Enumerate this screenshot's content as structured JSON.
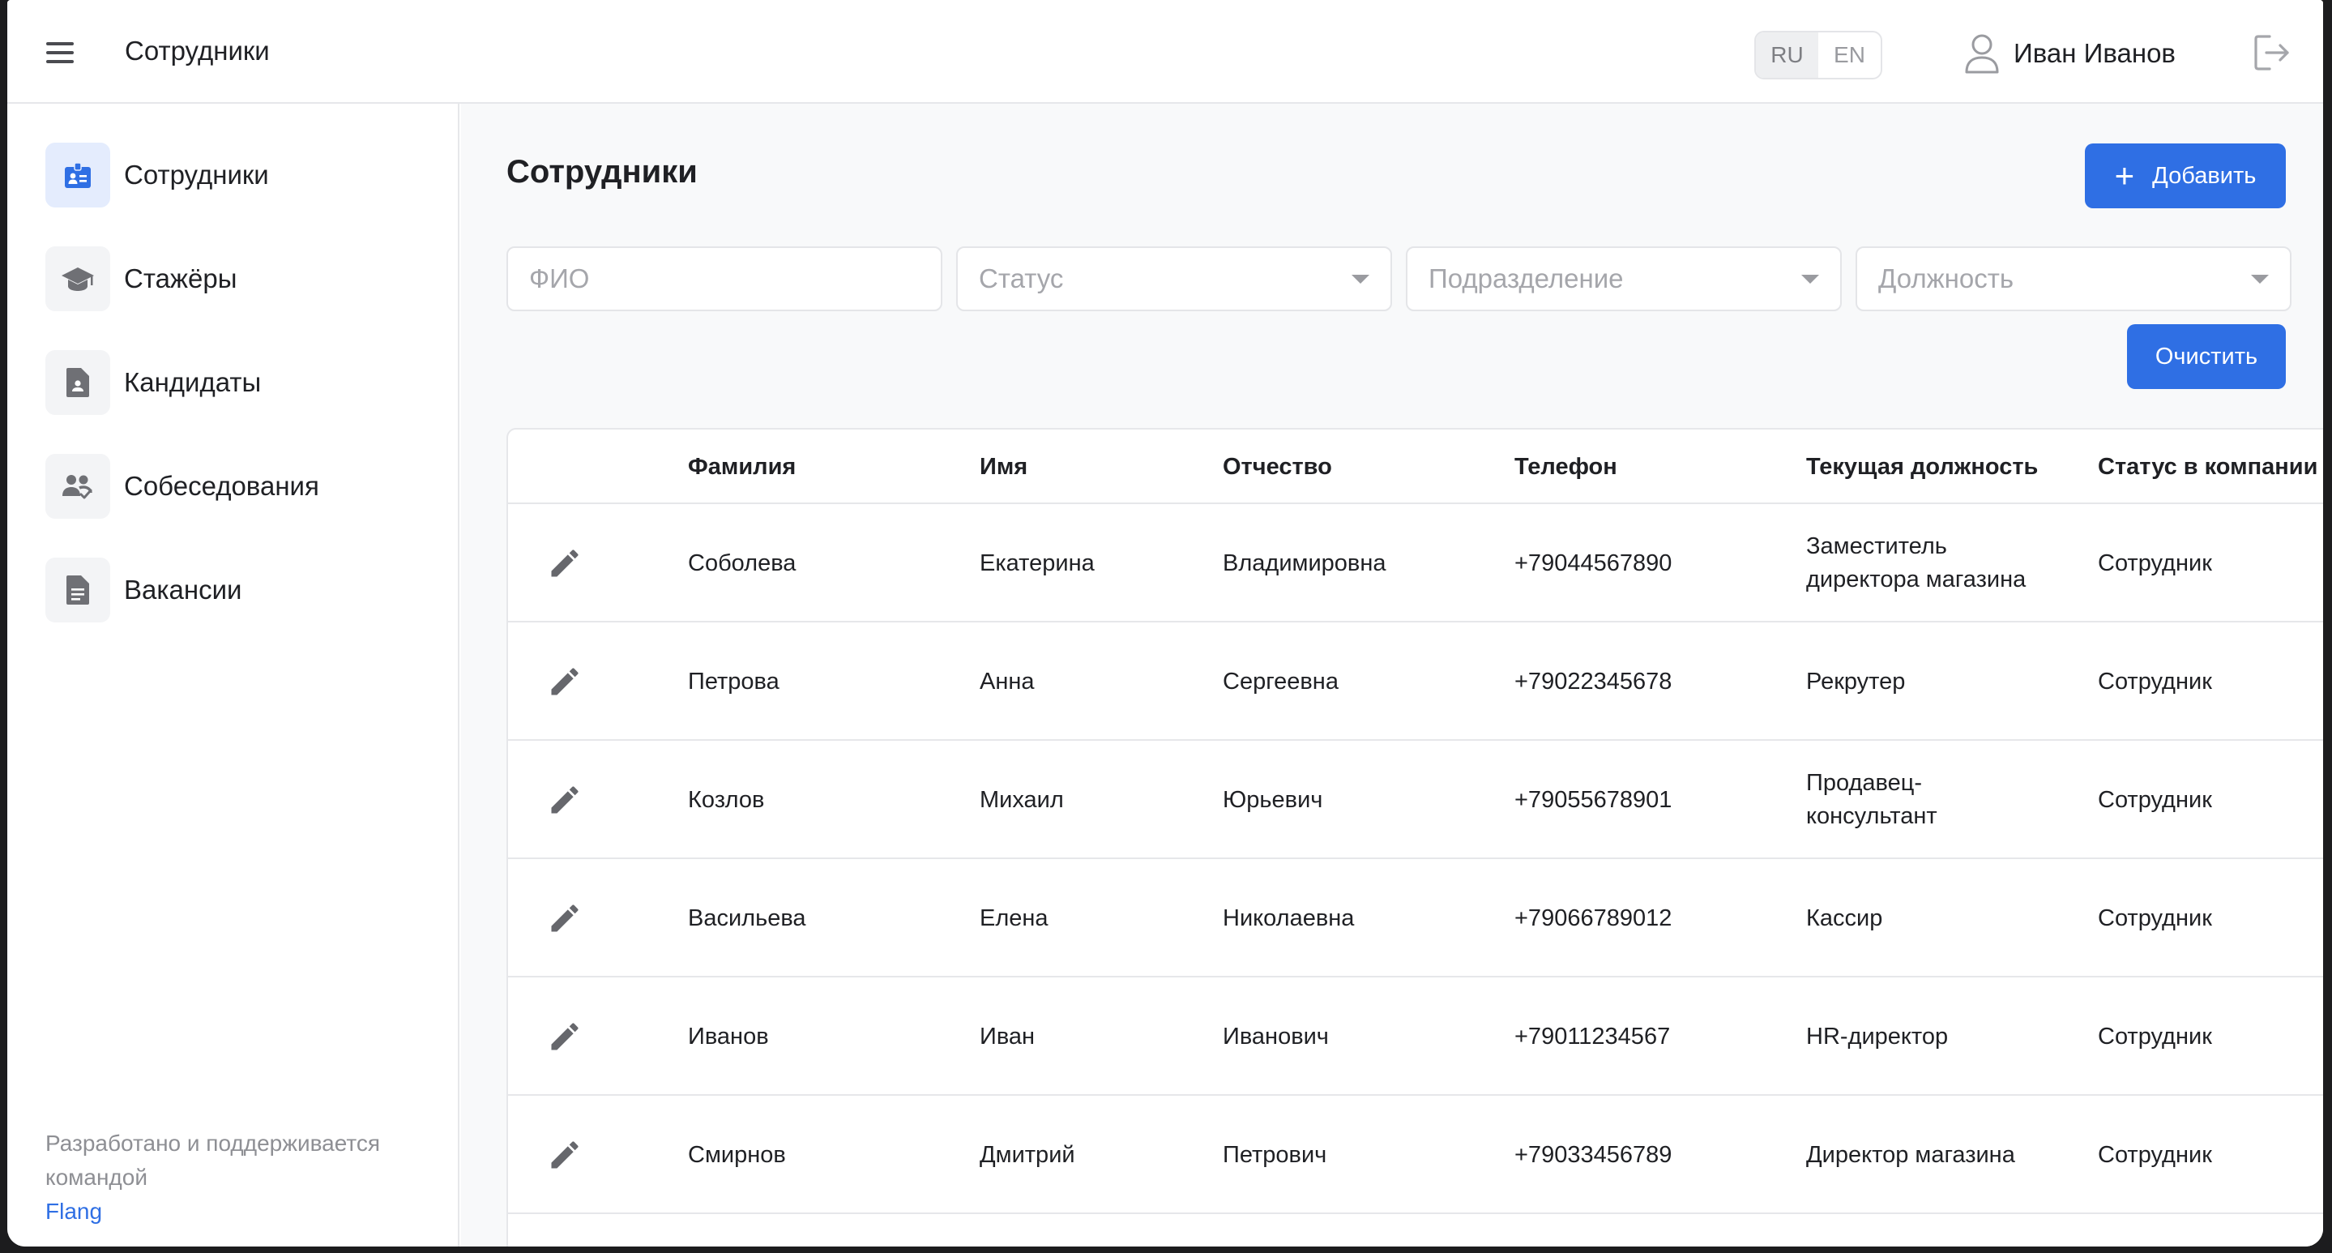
{
  "header": {
    "title": "Сотрудники",
    "lang": {
      "ru": "RU",
      "en": "EN"
    },
    "user_name": "Иван Иванов"
  },
  "sidebar": {
    "items": [
      {
        "label": "Сотрудники",
        "icon": "badge-icon",
        "active": true
      },
      {
        "label": "Стажёры",
        "icon": "graduation-cap-icon",
        "active": false
      },
      {
        "label": "Кандидаты",
        "icon": "person-document-icon",
        "active": false
      },
      {
        "label": "Собеседования",
        "icon": "people-interview-icon",
        "active": false
      },
      {
        "label": "Вакансии",
        "icon": "document-icon",
        "active": false
      }
    ],
    "footer_text": "Разработано и поддерживается командой",
    "footer_link": "Flang"
  },
  "main": {
    "title": "Сотрудники",
    "add_label": "Добавить",
    "clear_label": "Очистить",
    "filters": {
      "fio_placeholder": "ФИО",
      "status": "Статус",
      "department": "Подразделение",
      "position": "Должность"
    }
  },
  "table": {
    "columns": [
      "Фамилия",
      "Имя",
      "Отчество",
      "Телефон",
      "Текущая должность",
      "Статус в компании"
    ],
    "rows": [
      [
        "Соболева",
        "Екатерина",
        "Владимировна",
        "+79044567890",
        "Заместитель директора магазина",
        "Сотрудник"
      ],
      [
        "Петрова",
        "Анна",
        "Сергеевна",
        "+79022345678",
        "Рекрутер",
        "Сотрудник"
      ],
      [
        "Козлов",
        "Михаил",
        "Юрьевич",
        "+79055678901",
        "Продавец-консультант",
        "Сотрудник"
      ],
      [
        "Васильева",
        "Елена",
        "Николаевна",
        "+79066789012",
        "Кассир",
        "Сотрудник"
      ],
      [
        "Иванов",
        "Иван",
        "Иванович",
        "+79011234567",
        "HR-директор",
        "Сотрудник"
      ],
      [
        "Смирнов",
        "Дмитрий",
        "Петрович",
        "+79033456789",
        "Директор магазина",
        "Сотрудник"
      ]
    ]
  },
  "colors": {
    "accent": "#2f6fe4",
    "active_nav_bg": "#e4ecfd",
    "border": "#e6e7ea",
    "main_bg": "#f8f9fa"
  }
}
